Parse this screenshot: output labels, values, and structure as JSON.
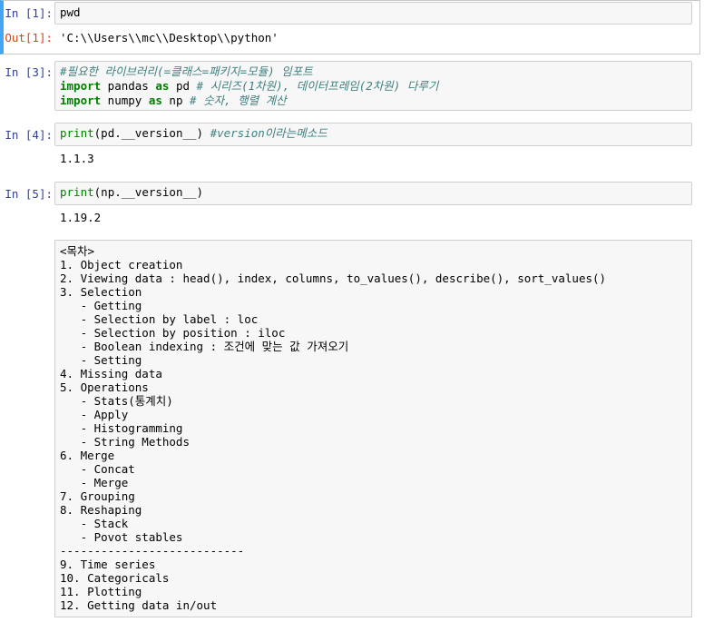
{
  "cells": {
    "c1": {
      "prompt_in": "In [1]:",
      "code": "pwd",
      "prompt_out": "Out[1]:",
      "output": "'C:\\\\Users\\\\mc\\\\Desktop\\\\python'"
    },
    "c3": {
      "prompt_in": "In [3]:",
      "line1_comment": "#필요한 라이브러리(=클래스=패키지=모듈) 임포트",
      "line2_kw1": "import",
      "line2_mod": " pandas ",
      "line2_kw2": "as",
      "line2_alias": " pd ",
      "line2_comment": "# 시리즈(1차원), 데이터프레임(2차원) 다루기",
      "line3_kw1": "import",
      "line3_mod": " numpy ",
      "line3_kw2": "as",
      "line3_alias": " np ",
      "line3_comment": "# 숫자, 행렬 계산"
    },
    "c4": {
      "prompt_in": "In [4]:",
      "fn": "print",
      "args": "(pd.__version__) ",
      "comment": "#version이라는메소드",
      "output": "1.1.3"
    },
    "c5": {
      "prompt_in": "In [5]:",
      "fn": "print",
      "args": "(np.__version__)",
      "output": "1.19.2"
    }
  },
  "toc_lines": [
    "<목차>",
    "1. Object creation",
    "2. Viewing data : head(), index, columns, to_values(), describe(), sort_values()",
    "3. Selection",
    "   - Getting",
    "   - Selection by label : loc",
    "   - Selection by position : iloc",
    "   - Boolean indexing : 조건에 맞는 값 가져오기",
    "   - Setting",
    "4. Missing data",
    "5. Operations",
    "   - Stats(통계치)",
    "   - Apply",
    "   - Histogramming",
    "   - String Methods",
    "6. Merge",
    "   - Concat",
    "   - Merge",
    "7. Grouping",
    "8. Reshaping",
    "   - Stack",
    "   - Povot stables",
    "---------------------------",
    "9. Time series",
    "10. Categoricals",
    "11. Plotting",
    "12. Getting data in/out"
  ]
}
